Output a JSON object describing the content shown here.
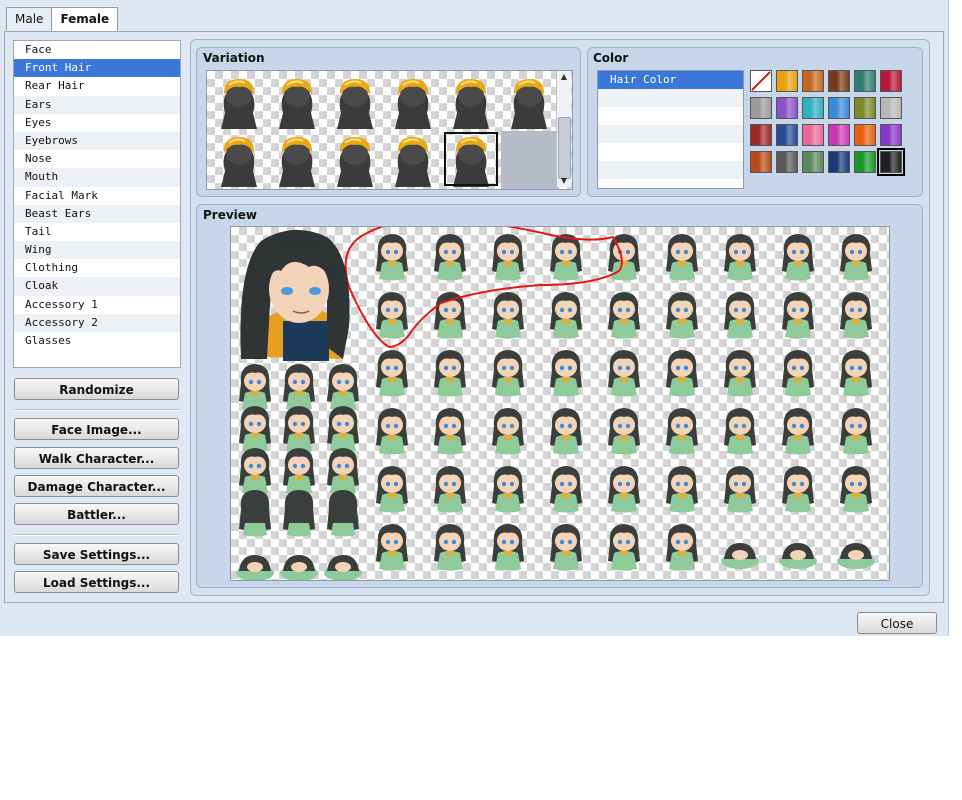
{
  "tabs": [
    {
      "label": "Male",
      "active": false
    },
    {
      "label": "Female",
      "active": true
    }
  ],
  "parts": [
    {
      "label": "Face",
      "selected": false
    },
    {
      "label": "Front Hair",
      "selected": true
    },
    {
      "label": "Rear Hair",
      "selected": false
    },
    {
      "label": "Ears",
      "selected": false
    },
    {
      "label": "Eyes",
      "selected": false
    },
    {
      "label": "Eyebrows",
      "selected": false
    },
    {
      "label": "Nose",
      "selected": false
    },
    {
      "label": "Mouth",
      "selected": false
    },
    {
      "label": "Facial Mark",
      "selected": false
    },
    {
      "label": "Beast Ears",
      "selected": false
    },
    {
      "label": "Tail",
      "selected": false
    },
    {
      "label": "Wing",
      "selected": false
    },
    {
      "label": "Clothing",
      "selected": false
    },
    {
      "label": "Cloak",
      "selected": false
    },
    {
      "label": "Accessory 1",
      "selected": false
    },
    {
      "label": "Accessory 2",
      "selected": false
    },
    {
      "label": "Glasses",
      "selected": false
    }
  ],
  "buttons": {
    "randomize": "Randomize",
    "face_image": "Face Image...",
    "walk_character": "Walk Character...",
    "damage_character": "Damage Character...",
    "battler": "Battler...",
    "save_settings": "Save Settings...",
    "load_settings": "Load Settings...",
    "close": "Close"
  },
  "variation": {
    "label": "Variation",
    "item_count": 11,
    "selected_index": 10
  },
  "color": {
    "label": "Color",
    "items": [
      {
        "label": "Hair Color",
        "selected": true
      },
      {
        "label": "",
        "selected": false
      },
      {
        "label": "",
        "selected": false
      },
      {
        "label": "",
        "selected": false
      },
      {
        "label": "",
        "selected": false
      },
      {
        "label": "",
        "selected": false
      }
    ],
    "swatches": [
      "none",
      "#e8a010",
      "#c86820",
      "#7a3a1a",
      "#2f7f72",
      "#b81838",
      "#9a9a9a",
      "#8a52c8",
      "#30b0c0",
      "#3a8ad8",
      "#7a8a28",
      "#b8b8b8",
      "#a02828",
      "#284a98",
      "#e86a9a",
      "#c838b0",
      "#e86010",
      "#8a38c8",
      "#b84a18",
      "#585858",
      "#5a8a5a",
      "#1a3a78",
      "#189828",
      "#202020"
    ],
    "selected_swatch": 23
  },
  "preview": {
    "label": "Preview",
    "hair_color": "#3a3f3b",
    "skin_color": "#f3d4b8",
    "outfit_color": "#8fca9a",
    "eye_color": "#3d8ad8",
    "annotation_color": "#e01818"
  }
}
